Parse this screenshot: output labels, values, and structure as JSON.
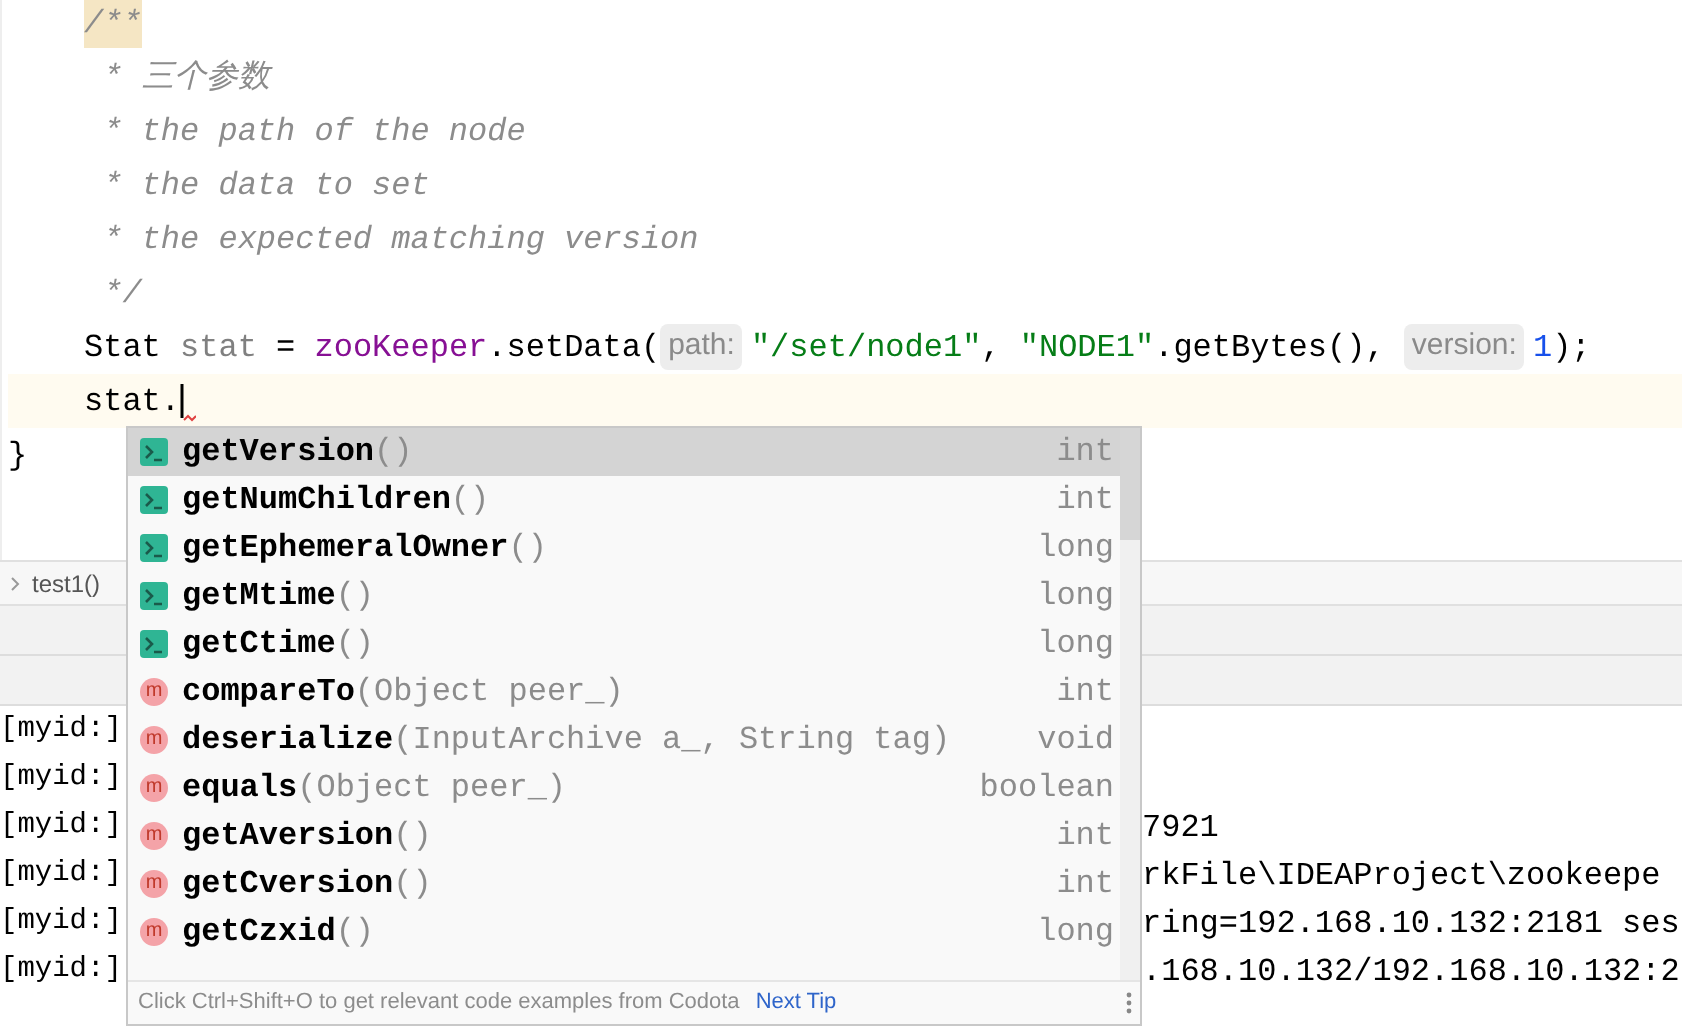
{
  "code_lines": [
    {
      "kind": "comment",
      "current": false,
      "segments": [
        {
          "text": "/**",
          "kind": "doc_start"
        }
      ]
    },
    {
      "kind": "comment",
      "current": false,
      "segments": [
        {
          "text": " * 三个参数",
          "kind": "comment"
        }
      ]
    },
    {
      "kind": "comment",
      "current": false,
      "segments": [
        {
          "text": " * the path of the node",
          "kind": "comment"
        }
      ]
    },
    {
      "kind": "comment",
      "current": false,
      "segments": [
        {
          "text": " * the data to set",
          "kind": "comment"
        }
      ]
    },
    {
      "kind": "comment",
      "current": false,
      "segments": [
        {
          "text": " * the expected matching version",
          "kind": "comment"
        }
      ]
    },
    {
      "kind": "comment",
      "current": false,
      "segments": [
        {
          "text": " */",
          "kind": "comment"
        }
      ]
    },
    {
      "kind": "code",
      "current": false,
      "segments": [
        {
          "text": "Stat ",
          "kind": "plain"
        },
        {
          "text": "stat",
          "kind": "unused"
        },
        {
          "text": " = ",
          "kind": "plain"
        },
        {
          "text": "zooKeeper",
          "kind": "field"
        },
        {
          "text": ".setData(",
          "kind": "plain"
        },
        {
          "text": "path:",
          "kind": "hint"
        },
        {
          "text": "\"/set/node1\"",
          "kind": "string"
        },
        {
          "text": ", ",
          "kind": "plain"
        },
        {
          "text": "\"NODE1\"",
          "kind": "string"
        },
        {
          "text": ".getBytes(), ",
          "kind": "plain"
        },
        {
          "text": "version:",
          "kind": "hint"
        },
        {
          "text": "1",
          "kind": "number"
        },
        {
          "text": ");",
          "kind": "plain"
        }
      ]
    },
    {
      "kind": "code",
      "current": true,
      "caret": true,
      "segments": [
        {
          "text": "stat.",
          "kind": "plain"
        }
      ]
    },
    {
      "kind": "closing",
      "current": false,
      "segments": [
        {
          "text": "}",
          "kind": "plain"
        }
      ]
    }
  ],
  "breadcrumb": {
    "label": "test1()"
  },
  "console": [
    {
      "prefix": "[myid:]"
    },
    {
      "prefix": "[myid:]"
    },
    {
      "prefix": "[myid:]",
      "rest": "7921"
    },
    {
      "prefix": "[myid:]",
      "rest": "rkFile\\IDEAProject\\zookeepe"
    },
    {
      "prefix": "[myid:]",
      "rest": "ring=192.168.10.132:2181 ses"
    },
    {
      "prefix": "[myid:]",
      "rest": ".168.10.132/192.168.10.132:2"
    }
  ],
  "completion": {
    "items": [
      {
        "kind": "property",
        "name": "getVersion",
        "params": "()",
        "type": "int",
        "selected": true
      },
      {
        "kind": "property",
        "name": "getNumChildren",
        "params": "()",
        "type": "int",
        "selected": false
      },
      {
        "kind": "property",
        "name": "getEphemeralOwner",
        "params": "()",
        "type": "long",
        "selected": false
      },
      {
        "kind": "property",
        "name": "getMtime",
        "params": "()",
        "type": "long",
        "selected": false
      },
      {
        "kind": "property",
        "name": "getCtime",
        "params": "()",
        "type": "long",
        "selected": false
      },
      {
        "kind": "method",
        "icon": "m",
        "name": "compareTo",
        "params": "(Object peer_)",
        "type": "int",
        "selected": false
      },
      {
        "kind": "method",
        "icon": "m",
        "name": "deserialize",
        "params": "(InputArchive a_, String tag)",
        "type": "void",
        "selected": false
      },
      {
        "kind": "method",
        "icon": "m",
        "name": "equals",
        "params": "(Object peer_)",
        "type": "boolean",
        "selected": false
      },
      {
        "kind": "method",
        "icon": "m",
        "name": "getAversion",
        "params": "()",
        "type": "int",
        "selected": false
      },
      {
        "kind": "method",
        "icon": "m",
        "name": "getCversion",
        "params": "()",
        "type": "int",
        "selected": false
      },
      {
        "kind": "method",
        "icon": "m",
        "name": "getCzxid",
        "params": "()",
        "type": "long",
        "selected": false
      }
    ],
    "footer": {
      "tip": "Click Ctrl+Shift+O to get relevant code examples from Codota",
      "link": "Next Tip"
    }
  }
}
